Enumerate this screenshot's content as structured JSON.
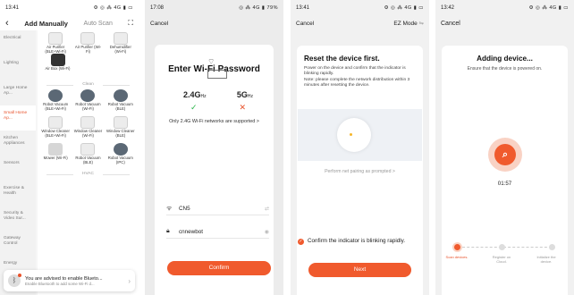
{
  "phone1": {
    "time": "13:41",
    "status_icons": "⚙ ◎ ⁂ 4G ▮ ▭",
    "back": "‹",
    "tab_manual": "Add Manually",
    "tab_auto": "Auto Scan",
    "scan_icon": "scan-icon",
    "categories": [
      {
        "label": "Electrical",
        "active": false
      },
      {
        "label": "Lighting",
        "active": false
      },
      {
        "label": "Large Home Ap...",
        "active": false
      },
      {
        "label": "Small Home Ap...",
        "active": true
      },
      {
        "label": "Kitchen Appliances",
        "active": false
      },
      {
        "label": "Sensors",
        "active": false
      },
      {
        "label": "Exercise & Health",
        "active": false
      },
      {
        "label": "Security & Video Sur...",
        "active": false
      },
      {
        "label": "Gateway Control",
        "active": false
      },
      {
        "label": "Energy",
        "active": false
      }
    ],
    "row1": [
      "Air Purifier (BLE+Wi-Fi)",
      "Air Purifier (Wi-Fi)",
      "Dehumidifier (Wi-Fi)"
    ],
    "row2": [
      "Air Box (Wi-Fi)"
    ],
    "section_clean": "Clean",
    "row3": [
      "Robot Vacuum (BLE+Wi-Fi)",
      "Robot Vacuum (Wi-Fi)",
      "Robot Vacuum (BLE)"
    ],
    "row4": [
      "Window Cleaner (BLE+Wi-Fi)",
      "Window Cleaner (Wi-Fi)",
      "Window Cleaner (BLE)"
    ],
    "row5": [
      "Mower (Wi-Fi)",
      "Robot Vacuum (BLE)",
      "Robot Vacuum (IPC)"
    ],
    "section_hvac": "HVAC",
    "toast_title": "You are advised to enable Blueto...",
    "toast_sub": "Enable Bluetooth to add some Wi-Fi d...",
    "toast_badge": "1"
  },
  "phone2": {
    "time": "17:08",
    "status_icons": "◎ ⁂ 4G ▮ 79%",
    "cancel": "Cancel",
    "title": "Enter Wi-Fi Password",
    "band1": "2.4G",
    "band2": "5G",
    "band_unit": "Hz",
    "note": "Only 2.4G Wi-Fi networks are supported >",
    "ssid": "CN5",
    "password": "cnnewbot",
    "confirm": "Confirm"
  },
  "phone3": {
    "time": "13:41",
    "status_icons": "⚙ ◎ ⁂ 4G ▮ ▭",
    "cancel": "Cancel",
    "mode": "EZ Mode",
    "mode_icon": "swap-icon",
    "title": "Reset the device first.",
    "body": "Power on the device and confirm that the indicator is blinking rapidly.\nNote: please complete the network distribution within 3 minutes after resetting the device.",
    "perform": "Perform net pairing as prompted >",
    "confirm_text": "Confirm the indicator is blinking rapidly.",
    "next": "Next"
  },
  "phone4": {
    "time": "13:42",
    "status_icons": "⚙ ◎ ⁂ 4G ▮ ▭",
    "cancel": "Cancel",
    "title": "Adding device...",
    "sub": "Ensure that the device is powered on.",
    "timer": "01:57",
    "steps": [
      "Scan devices.",
      "Register on Cloud.",
      "Initialize the device."
    ]
  },
  "colors": {
    "accent": "#f05a2d",
    "ok": "#2bb54a"
  }
}
